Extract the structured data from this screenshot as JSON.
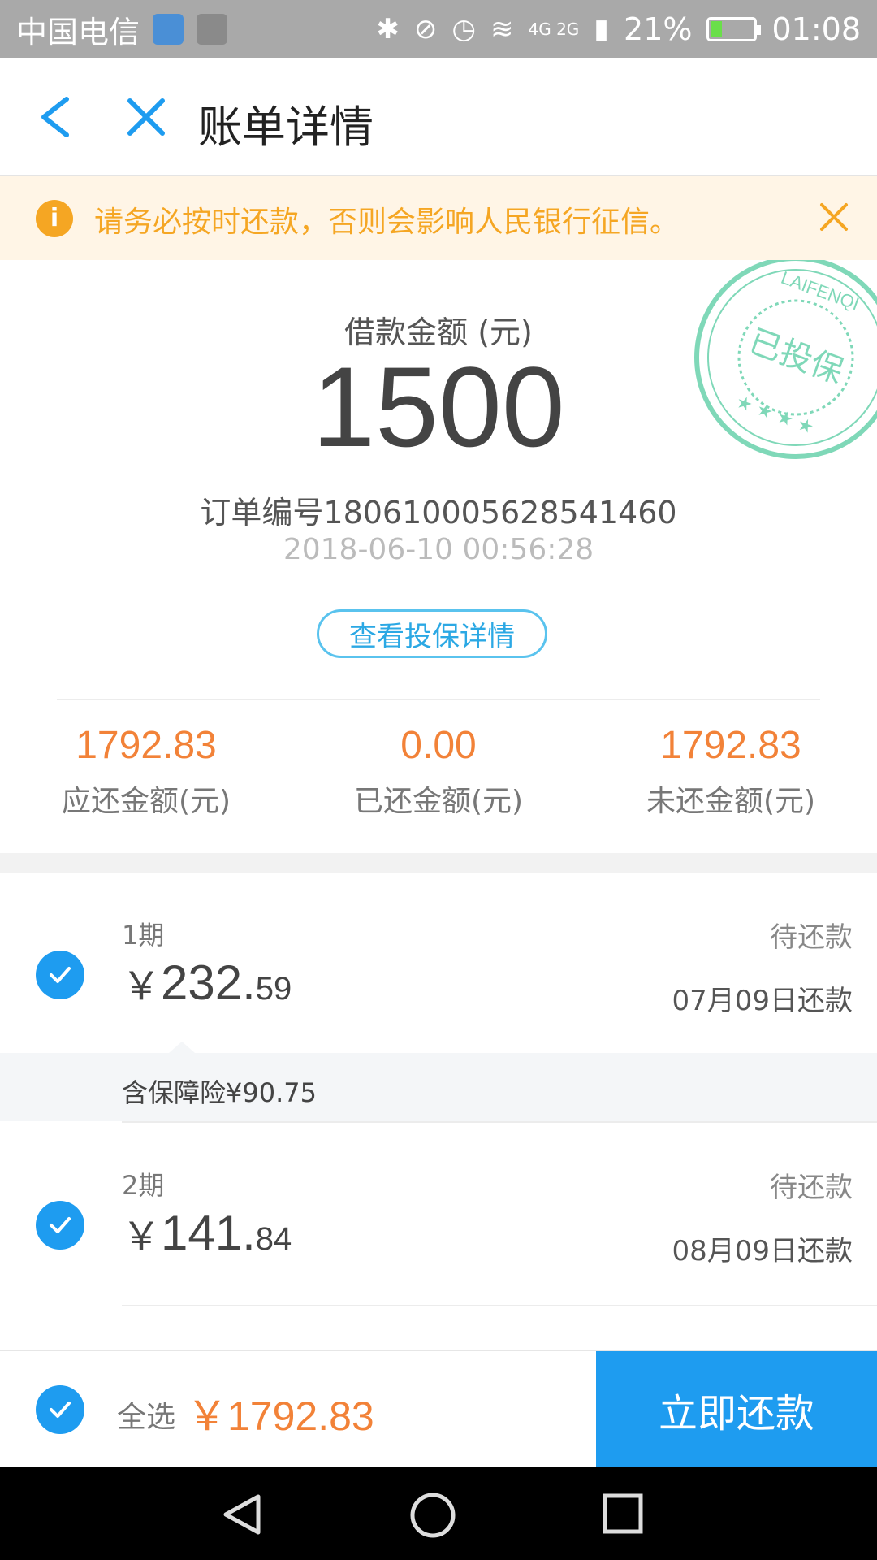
{
  "status_bar": {
    "carrier": "中国电信",
    "network_label": "4G 2G",
    "battery_percent": "21%",
    "time": "01:08"
  },
  "nav": {
    "title": "账单详情"
  },
  "notice": {
    "text": "请务必按时还款，否则会影响人民银行征信。"
  },
  "stamp": {
    "text": "已投保",
    "brand": "LAIFENQI"
  },
  "loan": {
    "label": "借款金额 (元)",
    "amount": "1500",
    "order_no": "订单编号180610005628541460",
    "order_time": "2018-06-10 00:56:28",
    "insurance_button": "查看投保详情"
  },
  "stats": [
    {
      "value": "1792.83",
      "label": "应还金额(元)"
    },
    {
      "value": "0.00",
      "label": "已还金额(元)"
    },
    {
      "value": "1792.83",
      "label": "未还金额(元)"
    }
  ],
  "installments": [
    {
      "period": "1期",
      "currency": "￥",
      "amount_int": "232.",
      "amount_dec": "59",
      "status": "待还款",
      "due": "07月09日还款",
      "note": "含保障险¥90.75"
    },
    {
      "period": "2期",
      "currency": "￥",
      "amount_int": "141.",
      "amount_dec": "84",
      "status": "待还款",
      "due": "08月09日还款"
    }
  ],
  "footer": {
    "select_all": "全选",
    "total": "￥1792.83",
    "pay_button": "立即还款"
  },
  "colors": {
    "primary": "#1e9cf0",
    "amount_orange": "#f28238",
    "notice_orange": "#f5a623",
    "stamp_green": "#7fd8b8"
  }
}
